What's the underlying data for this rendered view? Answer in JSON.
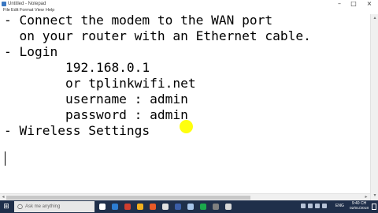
{
  "window": {
    "title": "Untitled - Notepad",
    "minimize": "–",
    "maximize": "□",
    "close": "×"
  },
  "menu": [
    "File",
    "Edit",
    "Format",
    "View",
    "Help"
  ],
  "editor": {
    "lines": [
      "- Connect the modem to the WAN port",
      "  on your router with an Ethernet cable.",
      "- Login",
      "        192.168.0.1",
      "        or tplinkwifi.net",
      "        username : admin",
      "        password : admin",
      "- Wireless Settings"
    ]
  },
  "taskbar": {
    "start_glyph": "⊞",
    "search_placeholder": "Ask me anything",
    "search_glyph": "○",
    "tray_language": "ENG",
    "clock_time": "9:40 CH",
    "clock_date": "02/01/2018",
    "app_colors": [
      "#ffffff",
      "#2d7dd2",
      "#cf3e2f",
      "#f2b01e",
      "#e85a28",
      "#e0e0e0",
      "#3b5ea8",
      "#a7c4e8",
      "#1ba94c",
      "#7f7f7f",
      "#d8d8d8"
    ]
  }
}
